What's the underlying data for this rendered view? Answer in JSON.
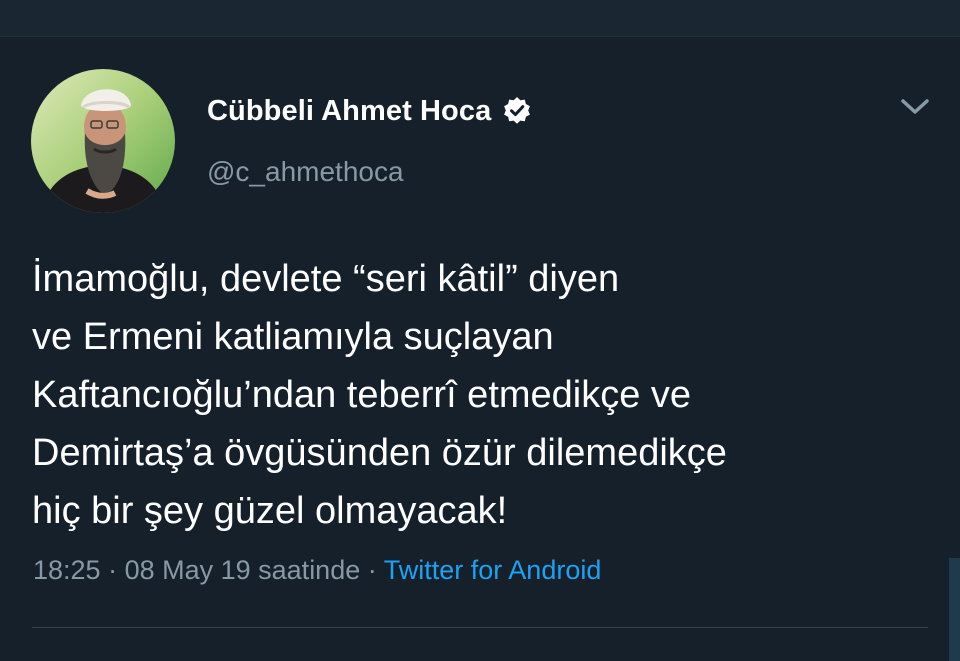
{
  "tweet": {
    "display_name": "Cübbeli Ahmet Hoca",
    "handle": "@c_ahmethoca",
    "verified": true,
    "text_lines": [
      "İmamoğlu, devlete “seri kâtil” diyen",
      "ve Ermeni katliamıyla suçlayan",
      "Kaftancıoğlu’ndan teberrî etmedikçe ve",
      "Demirtaş’a övgüsünden özür dilemedikçe",
      "hiç bir şey güzel olmayacak!"
    ],
    "time": "18:25",
    "separator": " · ",
    "date_label": "08 May 19 saatinde",
    "source": "Twitter for Android"
  },
  "icons": {
    "verified": "verified-badge-icon",
    "menu": "chevron-down-icon"
  },
  "colors": {
    "background": "#15202b",
    "primary_text": "#ffffff",
    "secondary_text": "#8899a6",
    "link": "#1da1f2",
    "divider": "#38444d"
  }
}
